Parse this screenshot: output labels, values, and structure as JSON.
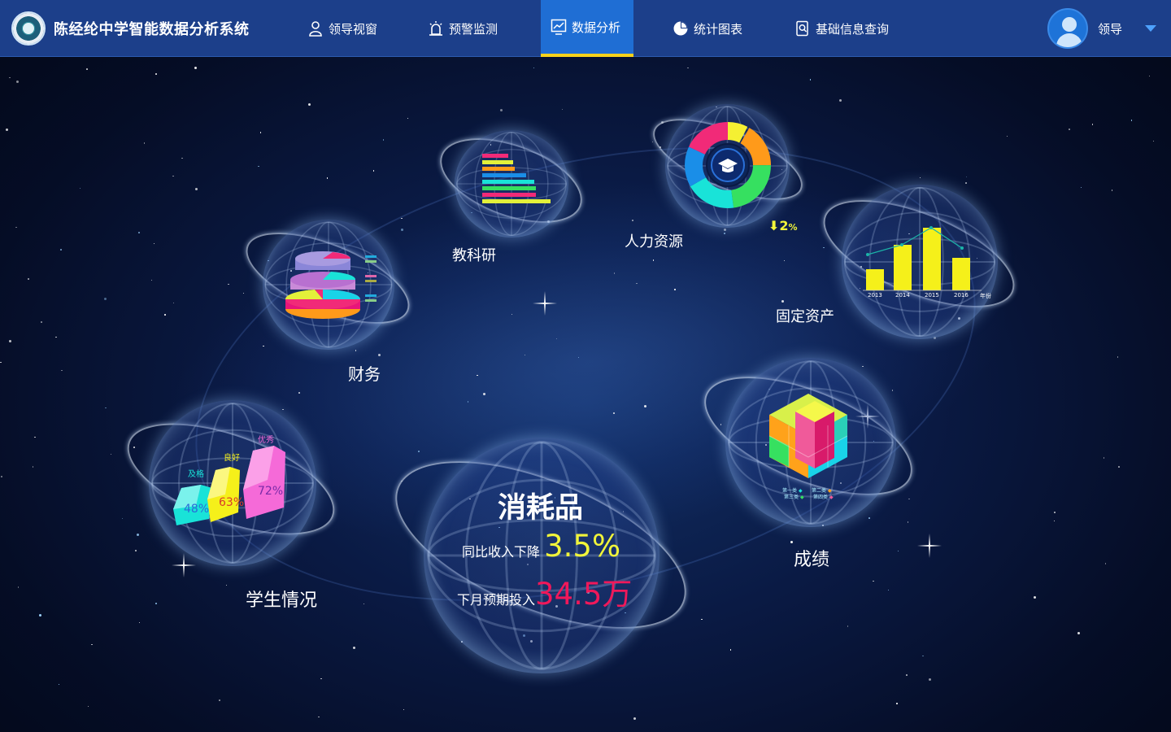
{
  "app": {
    "title": "陈经纶中学智能数据分析系统"
  },
  "nav": {
    "items": [
      {
        "label": "领导视窗",
        "icon": "person-icon",
        "active": false
      },
      {
        "label": "预警监测",
        "icon": "alarm-icon",
        "active": false
      },
      {
        "label": "数据分析",
        "icon": "analysis-icon",
        "active": true
      },
      {
        "label": "统计图表",
        "icon": "pie-chart-icon",
        "active": false
      },
      {
        "label": "基础信息查询",
        "icon": "document-search-icon",
        "active": false
      }
    ]
  },
  "user": {
    "name": "领导"
  },
  "modules": {
    "research": {
      "label": "教科研"
    },
    "hr": {
      "label": "人力资源",
      "change": "2",
      "change_unit": "%"
    },
    "assets": {
      "label": "固定资产",
      "years": [
        "2013",
        "2014",
        "2015",
        "2016"
      ],
      "axis_label": "年份"
    },
    "finance": {
      "label": "财务"
    },
    "students": {
      "label": "学生情况",
      "tiers": [
        {
          "name": "及格",
          "value": "48%"
        },
        {
          "name": "良好",
          "value": "63%"
        },
        {
          "name": "优秀",
          "value": "72%"
        }
      ]
    },
    "grades": {
      "label": "成绩",
      "legend": [
        "第一类",
        "第二类",
        "第三类",
        "第四类"
      ]
    },
    "consumables": {
      "title": "消耗品",
      "line1_text": "同比收入下降",
      "line1_value": "3.5%",
      "line2_text": "下月预期投入",
      "line2_value": "34.5万"
    }
  },
  "colors": {
    "topbar": "#1c3f8a",
    "active_tab": "#1f6ed4",
    "active_underline": "#f7d21a",
    "accent_yellow": "#f1f53a",
    "accent_red": "#f0185a"
  }
}
